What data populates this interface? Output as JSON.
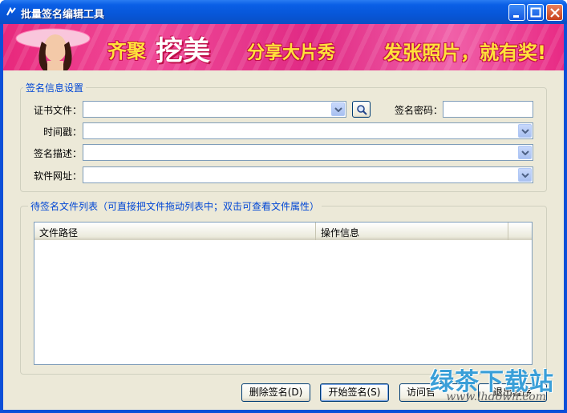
{
  "window": {
    "title": "批量签名编辑工具"
  },
  "banner": {
    "text1": "齐聚",
    "text2": "挖美",
    "text3": "分享大片秀",
    "text4": "发张照片，就有奖!"
  },
  "signature_settings": {
    "group_title": "签名信息设置",
    "cert_file_label": "证书文件：",
    "cert_file_value": "",
    "sign_password_label": "签名密码：",
    "sign_password_value": "",
    "timestamp_label": "时间戳：",
    "timestamp_value": "",
    "description_label": "签名描述：",
    "description_value": "",
    "software_url_label": "软件网址：",
    "software_url_value": ""
  },
  "file_list": {
    "group_title": "待签名文件列表（可直接把文件拖动列表中；双击可查看文件属性）",
    "columns": [
      "文件路径",
      "操作信息"
    ],
    "rows": []
  },
  "buttons": {
    "delete_sign": "删除签名(D)",
    "start_sign": "开始签名(S)",
    "visit": "访问官",
    "exit": "退出程序"
  },
  "watermark": {
    "main": "绿茶下载站",
    "url": "www.lhdown.com"
  },
  "colors": {
    "titlebar": "#0756d8",
    "client_bg": "#ece9d8",
    "group_title": "#0046d5",
    "banner_pink": "#e8287c"
  }
}
